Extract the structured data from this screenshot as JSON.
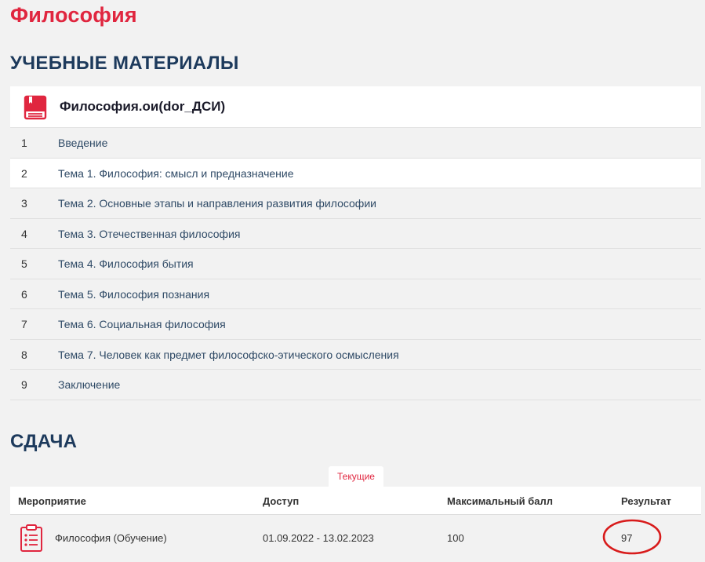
{
  "page": {
    "title": "Философия"
  },
  "materials": {
    "title": "УЧЕБНЫЕ МАТЕРИАЛЫ",
    "course_name": "Философия.ои(dor_ДСИ)",
    "course_icon": "book-icon",
    "topics": [
      {
        "num": "1",
        "label": "Введение"
      },
      {
        "num": "2",
        "label": "Тема 1. Философия: смысл и предназначение"
      },
      {
        "num": "3",
        "label": "Тема 2. Основные этапы и направления развития философии"
      },
      {
        "num": "4",
        "label": "Тема 3. Отечественная философия"
      },
      {
        "num": "5",
        "label": "Тема 4. Философия бытия"
      },
      {
        "num": "6",
        "label": "Тема 5. Философия познания"
      },
      {
        "num": "7",
        "label": "Тема 6. Социальная философия"
      },
      {
        "num": "8",
        "label": "Тема 7. Человек как предмет философско-этического осмысления"
      },
      {
        "num": "9",
        "label": "Заключение"
      }
    ]
  },
  "submission": {
    "title": "СДАЧА",
    "tab_current": "Текущие",
    "columns": {
      "event": "Мероприятие",
      "access": "Доступ",
      "max_score": "Максимальный балл",
      "result": "Результат"
    },
    "rows": [
      {
        "event": "Философия (Обучение)",
        "access": "01.09.2022 - 13.02.2023",
        "max_score": "100",
        "result": "97",
        "icon": "clipboard-list-icon"
      }
    ]
  },
  "colors": {
    "accent": "#e0263f",
    "heading": "#1d3a5c",
    "link": "#2f4a66",
    "background": "#f2f2f2",
    "annotation": "#d81b1b"
  }
}
